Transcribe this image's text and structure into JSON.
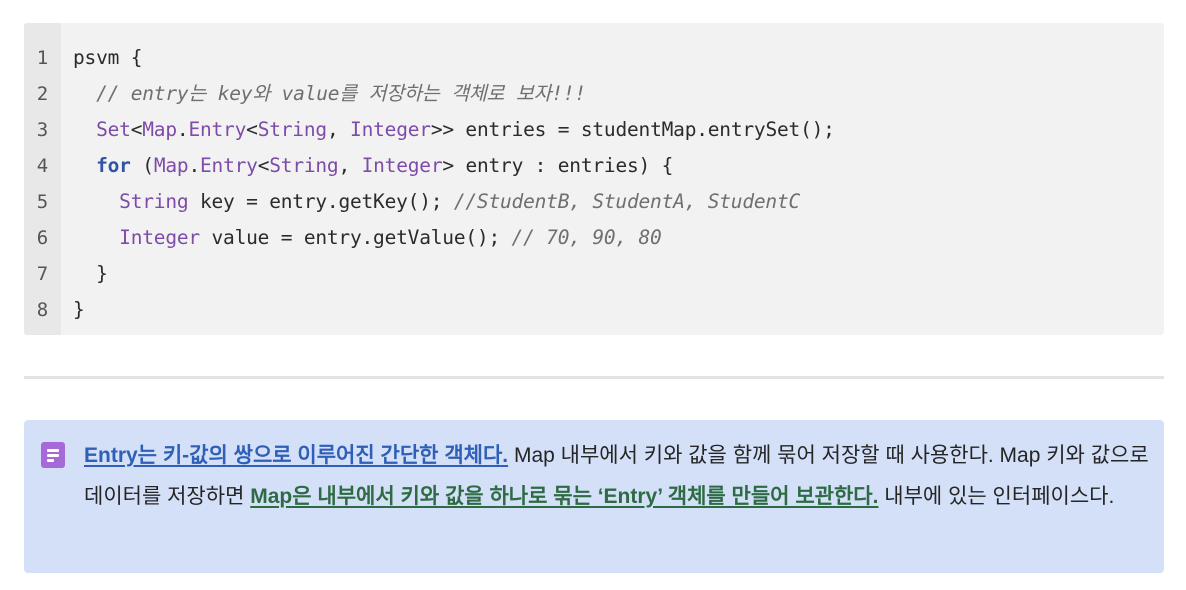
{
  "code_block": {
    "line_numbers": [
      "1",
      "2",
      "3",
      "4",
      "5",
      "6",
      "7",
      "8"
    ],
    "lines": [
      [
        {
          "t": "psvm {",
          "c": "tx"
        }
      ],
      [
        {
          "t": "  ",
          "c": "tx"
        },
        {
          "t": "// entry는 key와 value를 저장하는 객체로 보자!!!",
          "c": "cm"
        }
      ],
      [
        {
          "t": "  ",
          "c": "tx"
        },
        {
          "t": "Set",
          "c": "type"
        },
        {
          "t": "<",
          "c": "tx"
        },
        {
          "t": "Map",
          "c": "type"
        },
        {
          "t": ".",
          "c": "tx"
        },
        {
          "t": "Entry",
          "c": "type"
        },
        {
          "t": "<",
          "c": "tx"
        },
        {
          "t": "String",
          "c": "type"
        },
        {
          "t": ", ",
          "c": "tx"
        },
        {
          "t": "Integer",
          "c": "type"
        },
        {
          "t": ">> entries = studentMap.entrySet();",
          "c": "tx"
        }
      ],
      [
        {
          "t": "  ",
          "c": "tx"
        },
        {
          "t": "for",
          "c": "kw"
        },
        {
          "t": " (",
          "c": "tx"
        },
        {
          "t": "Map",
          "c": "type"
        },
        {
          "t": ".",
          "c": "tx"
        },
        {
          "t": "Entry",
          "c": "type"
        },
        {
          "t": "<",
          "c": "tx"
        },
        {
          "t": "String",
          "c": "type"
        },
        {
          "t": ", ",
          "c": "tx"
        },
        {
          "t": "Integer",
          "c": "type"
        },
        {
          "t": "> entry : entries) {",
          "c": "tx"
        }
      ],
      [
        {
          "t": "    ",
          "c": "tx"
        },
        {
          "t": "String",
          "c": "type"
        },
        {
          "t": " key = entry.getKey(); ",
          "c": "tx"
        },
        {
          "t": "//StudentB, StudentA, StudentC",
          "c": "cm"
        }
      ],
      [
        {
          "t": "    ",
          "c": "tx"
        },
        {
          "t": "Integer",
          "c": "type"
        },
        {
          "t": " value = entry.getValue(); ",
          "c": "tx"
        },
        {
          "t": "// 70, 90, 80",
          "c": "cm"
        }
      ],
      [
        {
          "t": "  }",
          "c": "tx"
        }
      ],
      [
        {
          "t": "}",
          "c": "tx"
        }
      ]
    ],
    "colors": {
      "type": "#7d4ba8",
      "keyword": "#2f55a8",
      "comment": "#6f6f6f",
      "text": "#2b2b2b",
      "background": "#f2f2f2"
    }
  },
  "callout": {
    "icon": "document-icon",
    "icon_color": "#a569d8",
    "background": "#d3e0f8",
    "link1": "Entry는 키-값의 쌍으로 이루어진 간단한 객체다.",
    "text1": " Map 내부에서 키와 값을 함께 묶어 저장할 때 사용한다. Map 키와 값으로 데이터를 저장하면 ",
    "link2": "Map은 내부에서 키와 값을 하나로 묶는 ‘Entry’ 객체를 만들어 보관한다.",
    "text2": " 내부에 있는 인터페이스다."
  }
}
